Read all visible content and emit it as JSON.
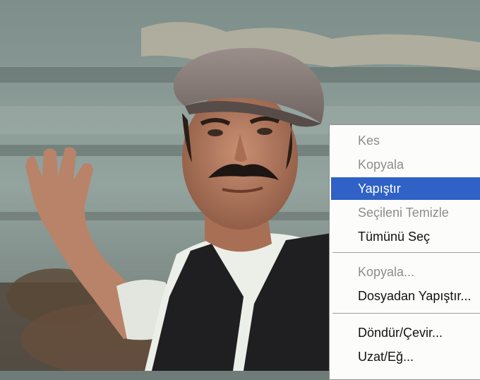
{
  "context_menu": {
    "items": [
      {
        "label": "Kes",
        "state": "disabled"
      },
      {
        "label": "Kopyala",
        "state": "disabled"
      },
      {
        "label": "Yapıştır",
        "state": "selected"
      },
      {
        "label": "Seçileni Temizle",
        "state": "disabled"
      },
      {
        "label": "Tümünü Seç",
        "state": "enabled"
      },
      {
        "label": "Kopyala...",
        "state": "disabled"
      },
      {
        "label": "Dosyadan Yapıştır...",
        "state": "enabled"
      },
      {
        "label": "Döndür/Çevir...",
        "state": "enabled"
      },
      {
        "label": "Uzat/Eğ...",
        "state": "enabled"
      }
    ]
  },
  "colors": {
    "highlight": "#2f61c7",
    "menu_background": "#fcfcfb",
    "disabled_text": "#8c8c8c"
  }
}
